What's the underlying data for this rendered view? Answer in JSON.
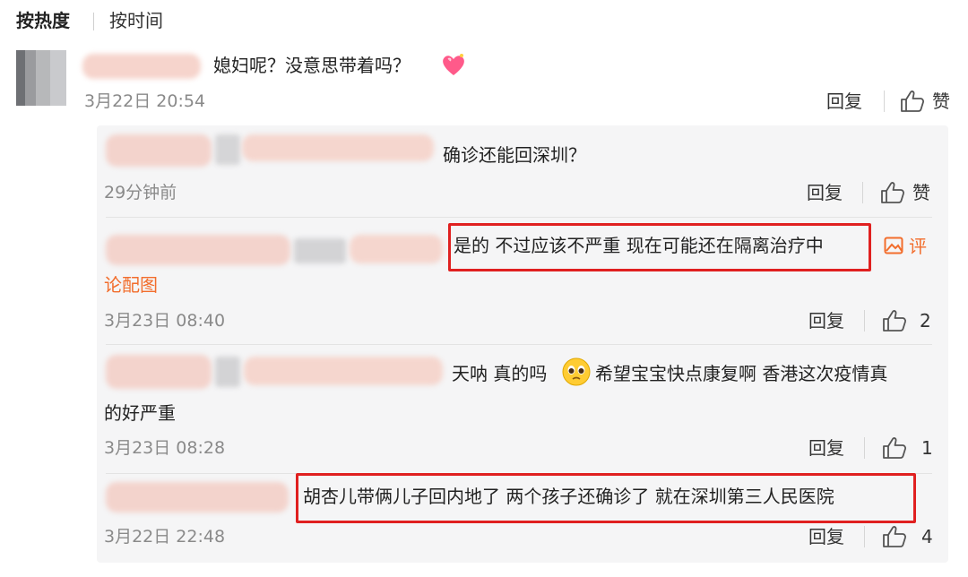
{
  "tabs": {
    "hot": "按热度",
    "time": "按时间"
  },
  "comment": {
    "text": "媳妇呢？没意思带着吗？",
    "time": "3月22日 20:54",
    "reply_label": "回复",
    "like_label": "赞"
  },
  "replies": [
    {
      "text": "确诊还能回深圳？",
      "time": "29分钟前",
      "reply_label": "回复",
      "like_label": "赞"
    },
    {
      "text": "是的 不过应该不严重 现在可能还在隔离治疗中",
      "image_link_a": "评",
      "image_link_b": "论配图",
      "time": "3月23日 08:40",
      "reply_label": "回复",
      "like_count": "2"
    },
    {
      "text_a": "天呐 真的吗",
      "text_b": "希望宝宝快点康复啊 香港这次疫情真",
      "text_c": "的好严重",
      "time": "3月23日 08:28",
      "reply_label": "回复",
      "like_count": "1"
    },
    {
      "text": "胡杏儿带俩儿子回内地了 两个孩子还确诊了 就在深圳第三人民医院",
      "time": "3月22日 22:48",
      "reply_label": "回复",
      "like_count": "4"
    }
  ],
  "colors": {
    "highlight_box": "#e02020",
    "link_orange": "#f26d2c",
    "panel_bg": "#f5f5f6"
  },
  "icons": {
    "like": "thumbs-up-icon",
    "image": "image-icon",
    "heart": "heart-emoji-icon",
    "pleading": "pleading-face-emoji-icon"
  }
}
